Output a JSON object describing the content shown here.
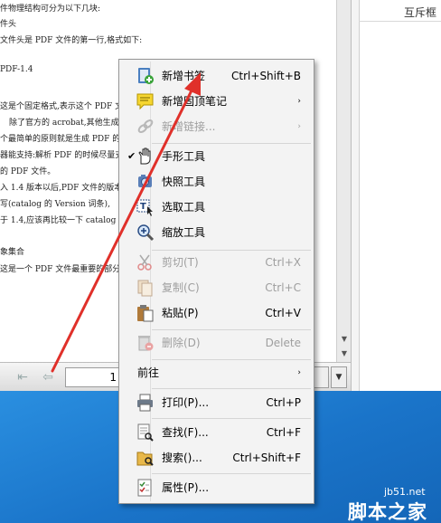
{
  "document": {
    "lines": [
      "件物理结构可分为以下几块:",
      "件头",
      "文件头是 PDF 文件的第一行,格式如下:",
      "PDF-1.4",
      "这是个固定格式,表示这个 PDF 文",
      "除了官方的 acrobat,其他生成",
      "个最简单的原则就是生成 PDF 的",
      "器能支持:解析 PDF 的时候尽量支",
      "的 PDF 文件。",
      "入 1.4 版本以后,PDF 文件的版本",
      "写(catalog 的 Version 词条),",
      "于 1.4,应该再比较一下 catalog",
      "象集合",
      "这是一个 PDF 文件最重要的部分,"
    ]
  },
  "right_panel": {
    "cell_text": "互斥框"
  },
  "navbar": {
    "page_value": "1"
  },
  "menu": {
    "items": [
      {
        "label": "新增书签",
        "shortcut": "Ctrl+Shift+B",
        "icon": "bookmark-add-icon",
        "disabled": false
      },
      {
        "label": "新增固顶笔记",
        "shortcut": "",
        "icon": "sticky-note-icon",
        "submenu": true,
        "disabled": false
      },
      {
        "label": "新增链接...",
        "shortcut": "",
        "icon": "link-icon",
        "submenu": true,
        "disabled": true
      },
      {
        "label": "手形工具",
        "shortcut": "",
        "icon": "hand-icon",
        "checked": true,
        "disabled": false
      },
      {
        "label": "快照工具",
        "shortcut": "",
        "icon": "camera-icon",
        "disabled": false
      },
      {
        "label": "选取工具",
        "shortcut": "",
        "icon": "select-text-icon",
        "disabled": false
      },
      {
        "label": "缩放工具",
        "shortcut": "",
        "icon": "zoom-icon",
        "disabled": false
      },
      {
        "label": "剪切(T)",
        "shortcut": "Ctrl+X",
        "icon": "scissors-icon",
        "disabled": true
      },
      {
        "label": "复制(C)",
        "shortcut": "Ctrl+C",
        "icon": "copy-icon",
        "disabled": true
      },
      {
        "label": "粘贴(P)",
        "shortcut": "Ctrl+V",
        "icon": "paste-icon",
        "disabled": false
      },
      {
        "label": "删除(D)",
        "shortcut": "Delete",
        "icon": "delete-icon",
        "disabled": true
      },
      {
        "label": "前往",
        "shortcut": "",
        "icon": "",
        "submenu": true,
        "disabled": false
      },
      {
        "label": "打印(P)...",
        "shortcut": "Ctrl+P",
        "icon": "printer-icon",
        "disabled": false
      },
      {
        "label": "查找(F)...",
        "shortcut": "Ctrl+F",
        "icon": "find-icon",
        "disabled": false
      },
      {
        "label": "搜索()...",
        "shortcut": "Ctrl+Shift+F",
        "icon": "search-folder-icon",
        "disabled": false
      },
      {
        "label": "属性(P)...",
        "shortcut": "",
        "icon": "properties-icon",
        "disabled": false
      }
    ],
    "submenu_arrow": "›"
  },
  "watermark": {
    "site": "jb51.net",
    "brand": "脚本之家"
  },
  "colors": {
    "desktop": "#1f7fd3",
    "arrow": "#e0302a"
  }
}
